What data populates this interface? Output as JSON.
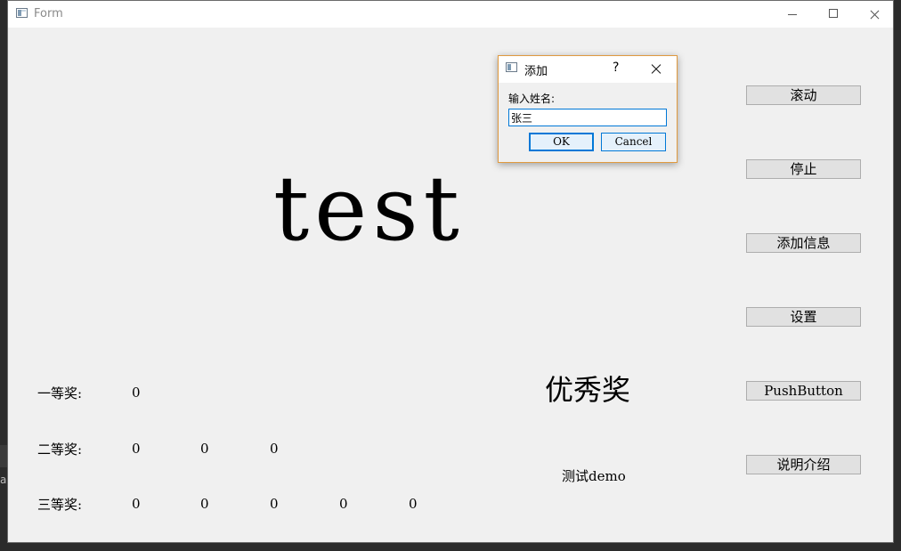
{
  "window": {
    "title": "Form"
  },
  "main": {
    "big_text": "test",
    "award_title": "优秀奖",
    "demo_text": "测试demo"
  },
  "prizes": {
    "first": {
      "label": "一等奖:",
      "values": [
        "0"
      ]
    },
    "second": {
      "label": "二等奖:",
      "values": [
        "0",
        "0",
        "0"
      ]
    },
    "third": {
      "label": "三等奖:",
      "values": [
        "0",
        "0",
        "0",
        "0",
        "0"
      ]
    }
  },
  "buttons": [
    "滚动",
    "停止",
    "添加信息",
    "设置",
    "PushButton",
    "说明介绍"
  ],
  "dialog": {
    "title": "添加",
    "help": "?",
    "prompt": "输入姓名:",
    "input_value": "张三",
    "ok_label": "OK",
    "cancel_label": "Cancel"
  },
  "background": {
    "partial_char": "a"
  },
  "colors": {
    "focus_accent": "#0078d7",
    "dialog_border": "#e09a3f",
    "window_bg": "#f0f0f0"
  }
}
